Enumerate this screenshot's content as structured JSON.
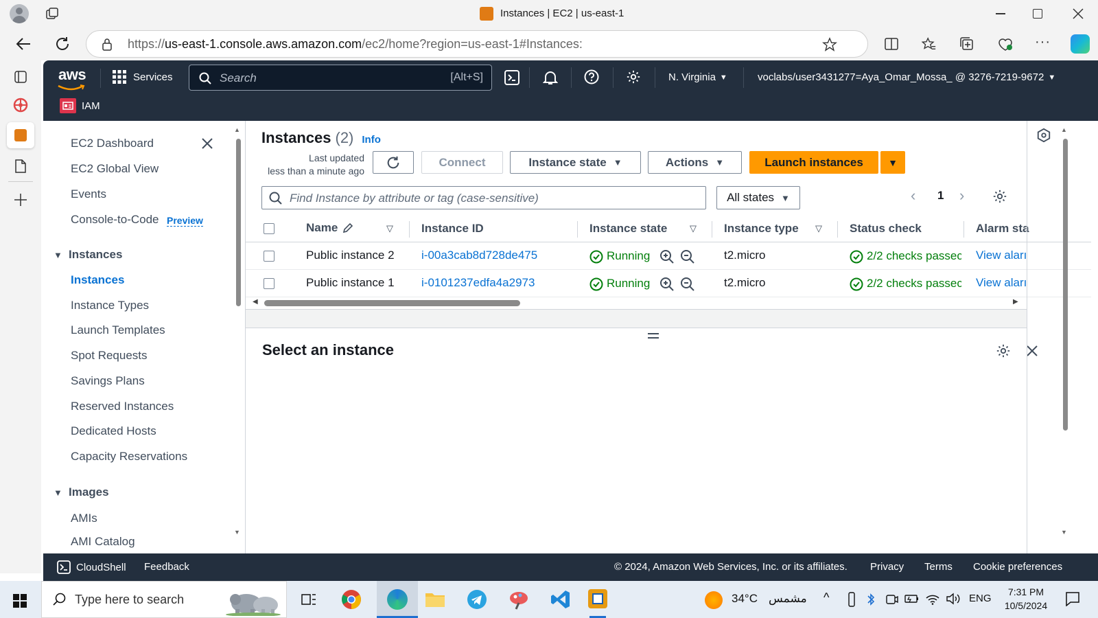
{
  "browser": {
    "tab_title": "Instances | EC2 | us-east-1",
    "url_prefix": "https://",
    "url_host": "us-east-1.console.aws.amazon.com",
    "url_path": "/ec2/home?region=us-east-1#Instances:"
  },
  "aws_nav": {
    "logo": "aws",
    "services_label": "Services",
    "search_placeholder": "Search",
    "search_shortcut": "[Alt+S]",
    "region": "N. Virginia",
    "account": "voclabs/user3431277=Aya_Omar_Mossa_ @ 3276-7219-9672",
    "favorite": "IAM"
  },
  "sidebar": {
    "top_items": [
      {
        "label": "EC2 Dashboard"
      },
      {
        "label": "EC2 Global View"
      },
      {
        "label": "Events"
      },
      {
        "label": "Console-to-Code",
        "badge": "Preview"
      }
    ],
    "sections": [
      {
        "title": "Instances",
        "items": [
          "Instances",
          "Instance Types",
          "Launch Templates",
          "Spot Requests",
          "Savings Plans",
          "Reserved Instances",
          "Dedicated Hosts",
          "Capacity Reservations"
        ]
      },
      {
        "title": "Images",
        "items": [
          "AMIs",
          "AMI Catalog"
        ]
      }
    ],
    "active_item": "Instances"
  },
  "instances_panel": {
    "title": "Instances",
    "count": "(2)",
    "info": "Info",
    "last_updated_1": "Last updated",
    "last_updated_2": "less than a minute ago",
    "connect": "Connect",
    "instance_state": "Instance state",
    "actions": "Actions",
    "launch": "Launch instances",
    "filter_placeholder": "Find Instance by attribute or tag (case-sensitive)",
    "states_filter": "All states",
    "page": "1",
    "columns": [
      "Name",
      "Instance ID",
      "Instance state",
      "Instance type",
      "Status check",
      "Alarm sta"
    ],
    "rows": [
      {
        "name": "Public instance 2",
        "id": "i-00a3cab8d728de475",
        "state": "Running",
        "type": "t2.micro",
        "status": "2/2 checks passec",
        "alarm": "View aları"
      },
      {
        "name": "Public instance 1",
        "id": "i-0101237edfa4a2973",
        "state": "Running",
        "type": "t2.micro",
        "status": "2/2 checks passec",
        "alarm": "View aları"
      }
    ]
  },
  "detail_panel": {
    "title": "Select an instance"
  },
  "footer": {
    "cloudshell": "CloudShell",
    "feedback": "Feedback",
    "copyright": "© 2024, Amazon Web Services, Inc. or its affiliates.",
    "privacy": "Privacy",
    "terms": "Terms",
    "cookies": "Cookie preferences"
  },
  "taskbar": {
    "search_placeholder": "Type here to search",
    "weather": "34°C",
    "weather_desc": "مشمس",
    "lang": "ENG",
    "time": "7:31 PM",
    "date": "10/5/2024"
  },
  "colors": {
    "aws_nav": "#232f3e",
    "launch_orange": "#ff9900",
    "link_blue": "#0972d3",
    "running_green": "#037f0c"
  }
}
